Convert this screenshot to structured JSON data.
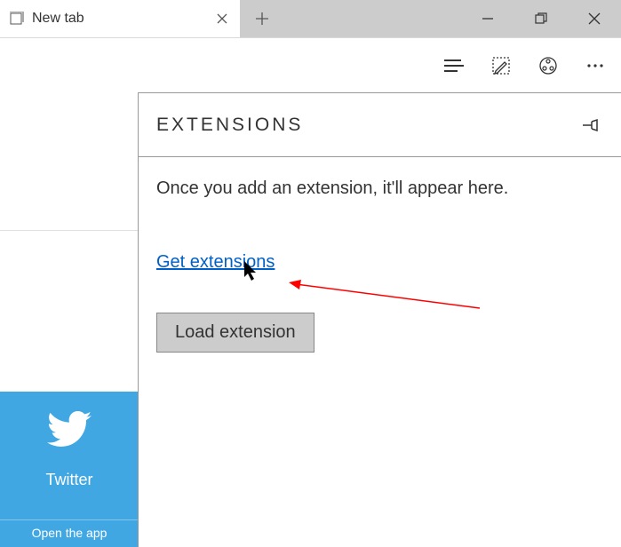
{
  "tab": {
    "title": "New tab"
  },
  "panel": {
    "title": "EXTENSIONS",
    "empty_text": "Once you add an extension, it'll appear here.",
    "get_link": "Get extensions",
    "load_button": "Load extension"
  },
  "tile": {
    "name": "Twitter",
    "cta": "Open the app"
  }
}
